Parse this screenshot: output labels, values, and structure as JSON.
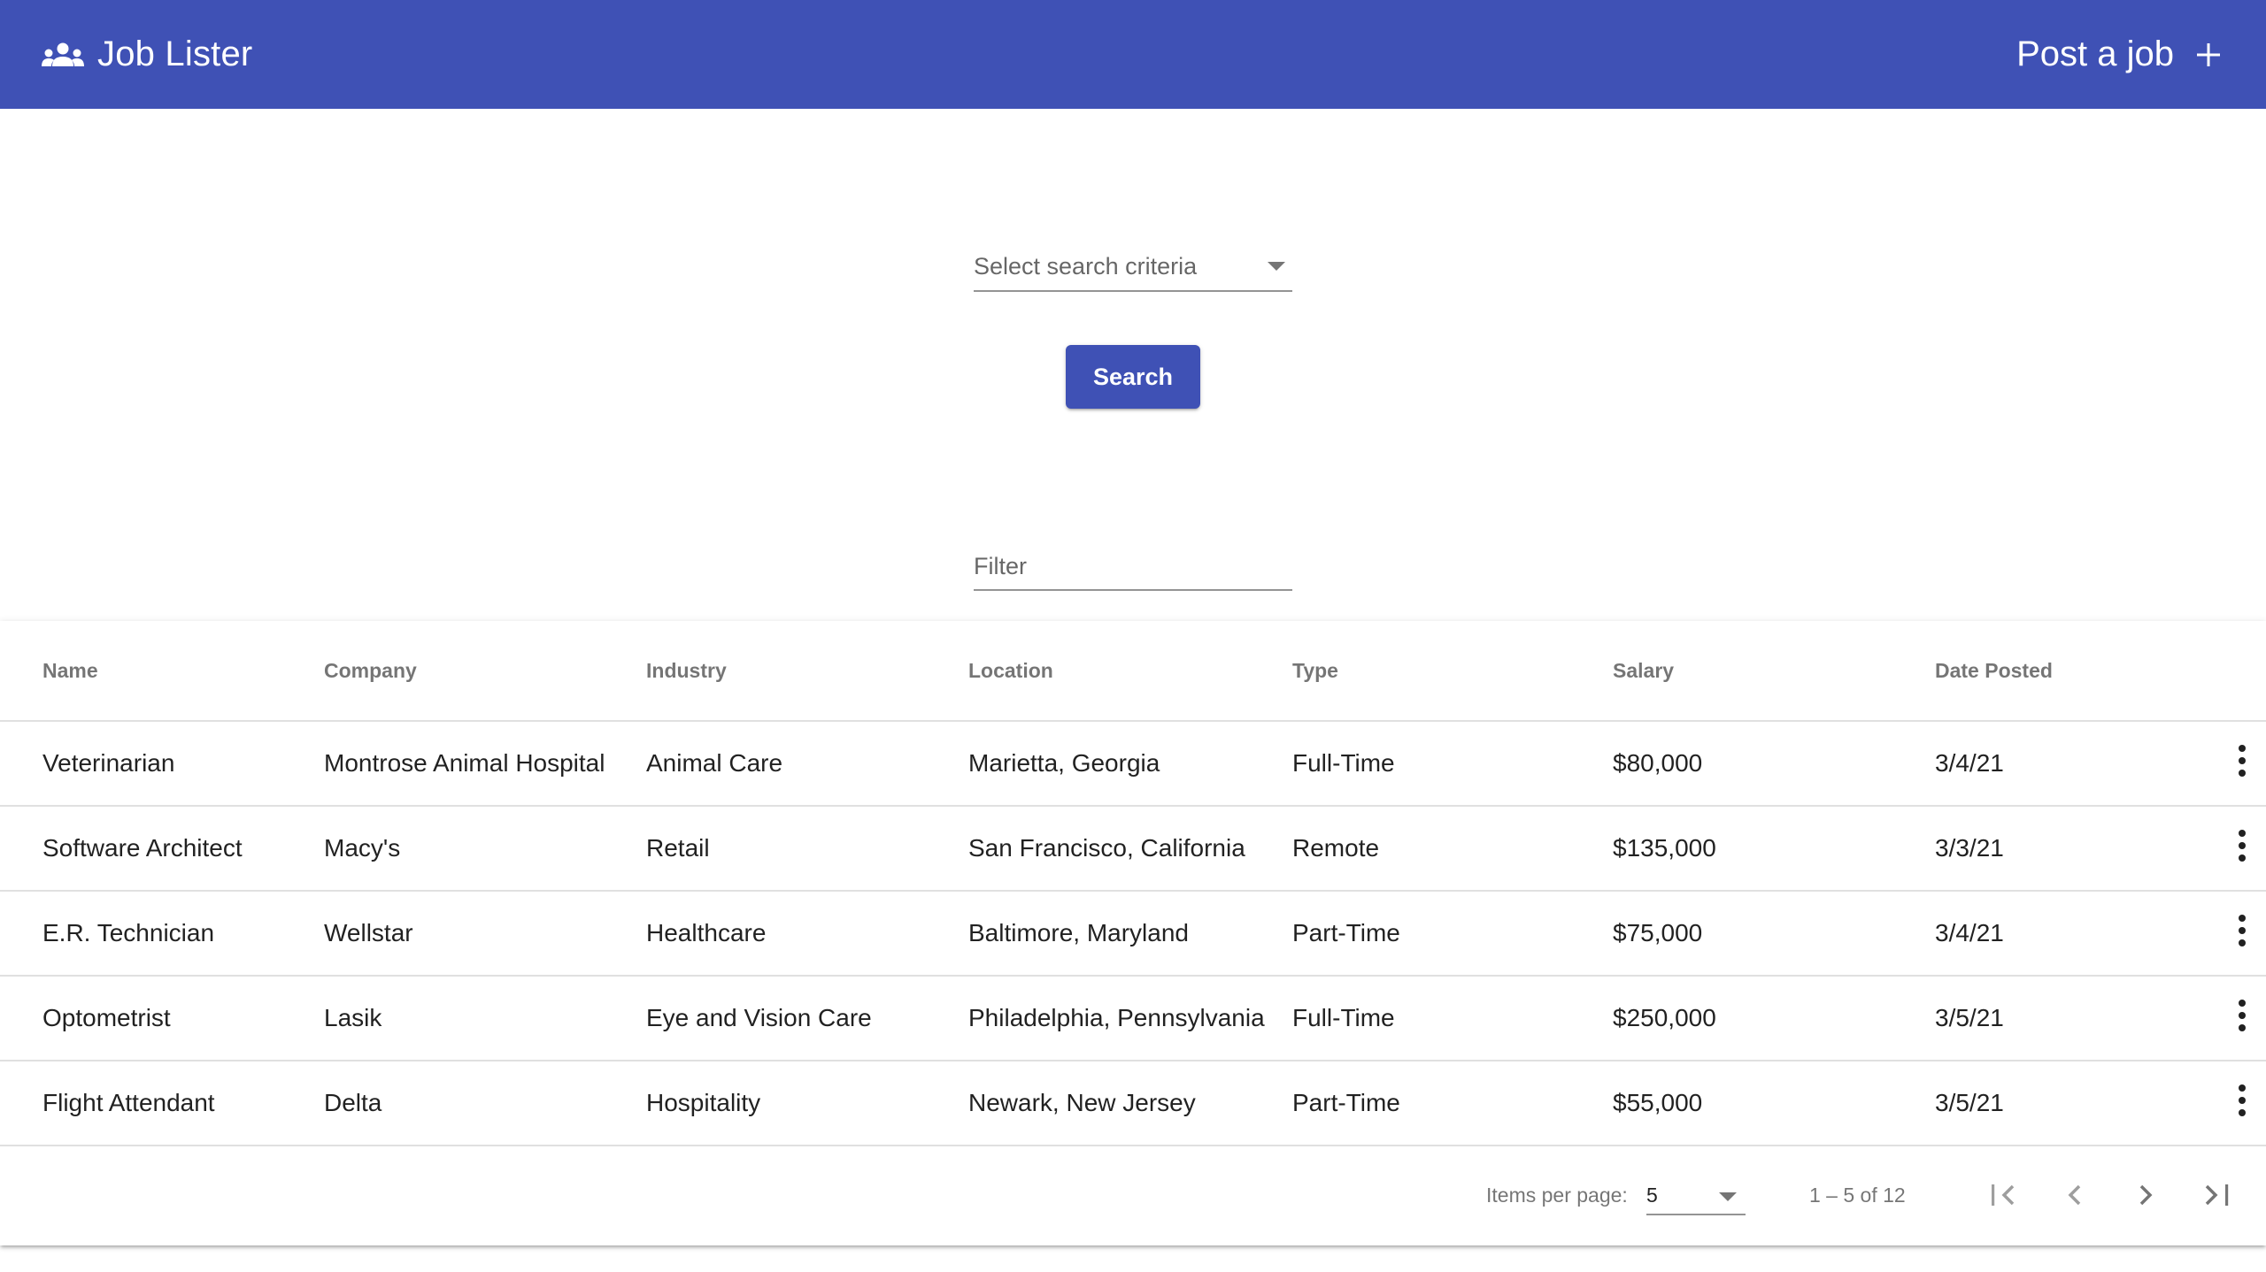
{
  "app": {
    "title": "Job Lister",
    "post_label": "Post a job",
    "accent_color": "#3f51b5",
    "brand_icon": "people-icon",
    "post_icon": "plus-icon"
  },
  "search": {
    "criteria_placeholder": "Select search criteria",
    "button_label": "Search",
    "filter_placeholder": "Filter"
  },
  "table": {
    "columns": [
      "Name",
      "Company",
      "Industry",
      "Location",
      "Type",
      "Salary",
      "Date Posted"
    ],
    "rows": [
      {
        "name": "Veterinarian",
        "company": "Montrose Animal Hospital",
        "industry": "Animal Care",
        "location": "Marietta, Georgia",
        "type": "Full-Time",
        "salary": "$80,000",
        "date": "3/4/21"
      },
      {
        "name": "Software Architect",
        "company": "Macy's",
        "industry": "Retail",
        "location": "San Francisco, California",
        "type": "Remote",
        "salary": "$135,000",
        "date": "3/3/21"
      },
      {
        "name": "E.R. Technician",
        "company": "Wellstar",
        "industry": "Healthcare",
        "location": "Baltimore, Maryland",
        "type": "Part-Time",
        "salary": "$75,000",
        "date": "3/4/21"
      },
      {
        "name": "Optometrist",
        "company": "Lasik",
        "industry": "Eye and Vision Care",
        "location": "Philadelphia, Pennsylvania",
        "type": "Full-Time",
        "salary": "$250,000",
        "date": "3/5/21"
      },
      {
        "name": "Flight Attendant",
        "company": "Delta",
        "industry": "Hospitality",
        "location": "Newark, New Jersey",
        "type": "Part-Time",
        "salary": "$55,000",
        "date": "3/5/21"
      }
    ],
    "row_menu_icon": "more-vert-icon"
  },
  "paginator": {
    "items_per_page_label": "Items per page:",
    "items_per_page": "5",
    "range_label": "1 – 5 of 12"
  }
}
